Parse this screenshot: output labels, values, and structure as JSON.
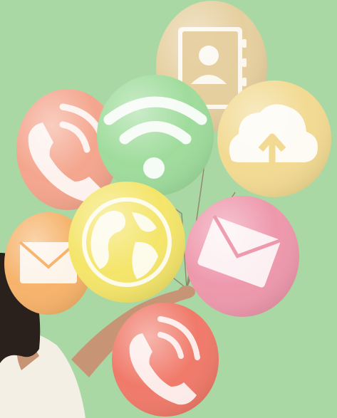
{
  "scene": {
    "background_color": "#a9d8a4",
    "balloons": [
      {
        "icon": "contacts-book-icon",
        "color": "#e6cf9f"
      },
      {
        "icon": "phone-call-icon",
        "color": "#f4a58d"
      },
      {
        "icon": "wifi-icon",
        "color": "#9fdc9c"
      },
      {
        "icon": "cloud-upload-icon",
        "color": "#f2da92"
      },
      {
        "icon": "mail-envelope-icon",
        "color": "#f6b36b"
      },
      {
        "icon": "globe-icon",
        "color": "#f4e56a"
      },
      {
        "icon": "mail-envelope-icon",
        "color": "#ee98ac"
      },
      {
        "icon": "phone-call-icon",
        "color": "#f07a6a"
      }
    ],
    "person": {
      "hair_color": "#2a211c",
      "skin_color": "#c89476",
      "shirt_color": "#f3efe4"
    }
  }
}
